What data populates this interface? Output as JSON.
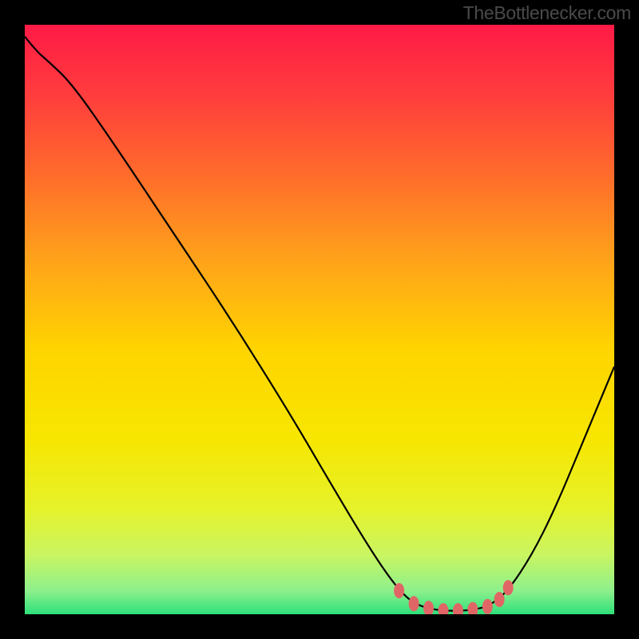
{
  "watermark": "TheBottlenecker.com",
  "chart_data": {
    "type": "line",
    "title": "",
    "xlabel": "",
    "ylabel": "",
    "xlim": [
      0,
      100
    ],
    "ylim": [
      0,
      100
    ],
    "background_gradient": {
      "stops": [
        {
          "offset": 0.0,
          "color": "#ff1a46"
        },
        {
          "offset": 0.12,
          "color": "#ff3d3d"
        },
        {
          "offset": 0.25,
          "color": "#ff6a2c"
        },
        {
          "offset": 0.4,
          "color": "#ffa31a"
        },
        {
          "offset": 0.55,
          "color": "#ffd400"
        },
        {
          "offset": 0.7,
          "color": "#f7e600"
        },
        {
          "offset": 0.82,
          "color": "#e6f22a"
        },
        {
          "offset": 0.9,
          "color": "#c9f562"
        },
        {
          "offset": 0.96,
          "color": "#8ef08c"
        },
        {
          "offset": 1.0,
          "color": "#2de07a"
        }
      ]
    },
    "series": [
      {
        "name": "curve",
        "color": "#000000",
        "width": 2.2,
        "points": [
          {
            "x": 0.0,
            "y": 98.0
          },
          {
            "x": 2.0,
            "y": 95.5
          },
          {
            "x": 4.0,
            "y": 93.8
          },
          {
            "x": 8.0,
            "y": 90.0
          },
          {
            "x": 15.0,
            "y": 80.0
          },
          {
            "x": 25.0,
            "y": 65.0
          },
          {
            "x": 35.0,
            "y": 50.0
          },
          {
            "x": 45.0,
            "y": 34.0
          },
          {
            "x": 52.0,
            "y": 22.0
          },
          {
            "x": 58.0,
            "y": 12.0
          },
          {
            "x": 62.0,
            "y": 6.0
          },
          {
            "x": 65.0,
            "y": 2.5
          },
          {
            "x": 68.0,
            "y": 1.0
          },
          {
            "x": 72.0,
            "y": 0.5
          },
          {
            "x": 76.0,
            "y": 0.7
          },
          {
            "x": 79.0,
            "y": 1.5
          },
          {
            "x": 82.0,
            "y": 4.0
          },
          {
            "x": 86.0,
            "y": 10.0
          },
          {
            "x": 90.0,
            "y": 18.0
          },
          {
            "x": 95.0,
            "y": 30.0
          },
          {
            "x": 100.0,
            "y": 42.0
          }
        ]
      }
    ],
    "markers": [
      {
        "x": 63.5,
        "y": 4.0,
        "color": "#e06666"
      },
      {
        "x": 66.0,
        "y": 1.8,
        "color": "#e06666"
      },
      {
        "x": 68.5,
        "y": 1.0,
        "color": "#e06666"
      },
      {
        "x": 71.0,
        "y": 0.6,
        "color": "#e06666"
      },
      {
        "x": 73.5,
        "y": 0.6,
        "color": "#e06666"
      },
      {
        "x": 76.0,
        "y": 0.8,
        "color": "#e06666"
      },
      {
        "x": 78.5,
        "y": 1.3,
        "color": "#e06666"
      },
      {
        "x": 80.5,
        "y": 2.5,
        "color": "#e06666"
      },
      {
        "x": 82.0,
        "y": 4.5,
        "color": "#e06666"
      }
    ]
  }
}
